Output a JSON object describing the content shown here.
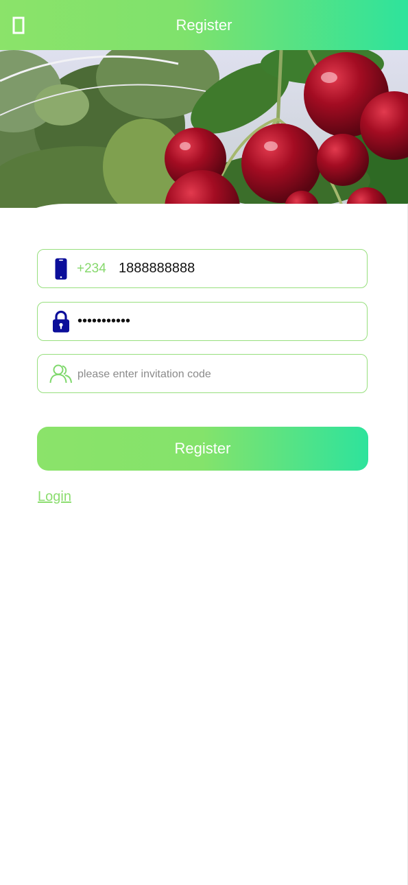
{
  "header": {
    "title": "Register",
    "back_icon": "back-icon"
  },
  "hero": {
    "image": "cherries-on-branch"
  },
  "form": {
    "phone": {
      "icon": "phone-icon",
      "country_code": "+234",
      "value": "1888888888"
    },
    "password": {
      "icon": "lock-icon",
      "value": "•••••••••••"
    },
    "invitation": {
      "icon": "users-icon",
      "placeholder": "please enter invitation code"
    },
    "submit_label": "Register",
    "login_link": "Login"
  },
  "colors": {
    "accent_green": "#8be36a",
    "accent_teal": "#2ee39c",
    "icon_navy": "#0b0e9a",
    "border": "#96df7c"
  }
}
